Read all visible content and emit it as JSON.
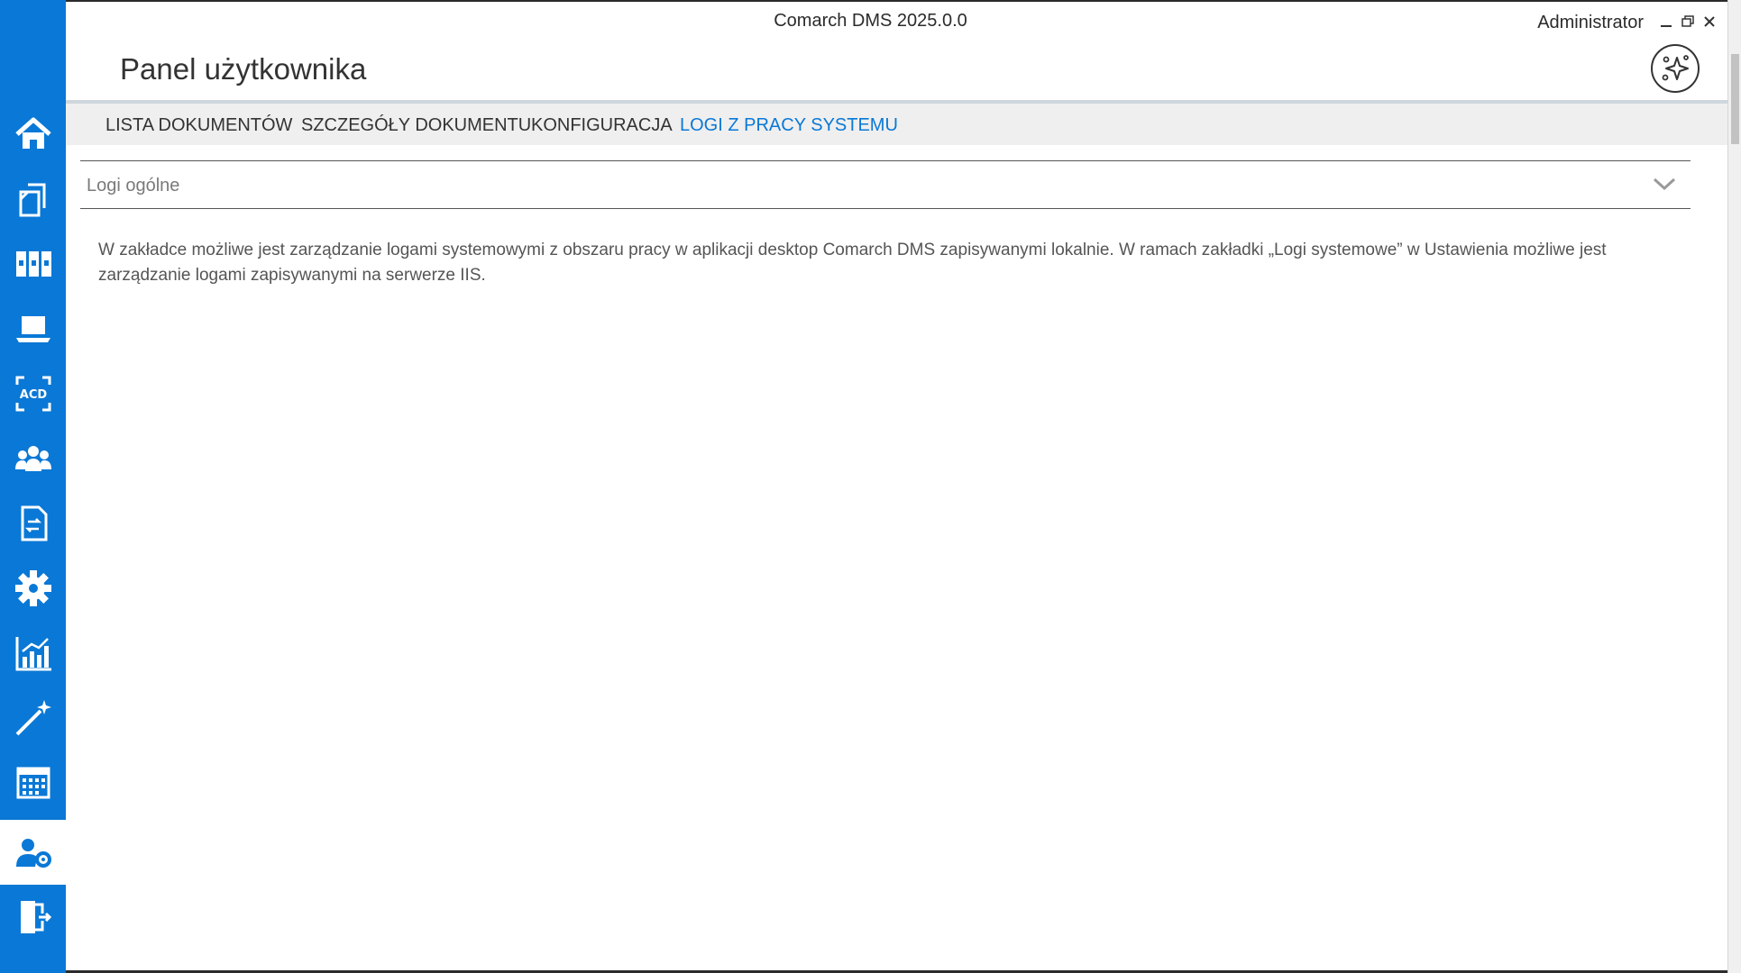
{
  "window": {
    "title": "Comarch DMS 2025.0.0",
    "user": "Administrator",
    "controls": [
      "minimize-icon",
      "restore-icon",
      "close-icon"
    ]
  },
  "page": {
    "title": "Panel użytkownika"
  },
  "sidebar": {
    "items": [
      {
        "name": "home",
        "icon": "home-icon"
      },
      {
        "name": "documents",
        "icon": "documents-icon"
      },
      {
        "name": "repository",
        "icon": "binders-icon"
      },
      {
        "name": "workstation",
        "icon": "laptop-icon"
      },
      {
        "name": "ocr",
        "icon": "acd-scan-icon",
        "label": "ACD"
      },
      {
        "name": "users",
        "icon": "group-icon"
      },
      {
        "name": "workflow",
        "icon": "document-exchange-icon"
      },
      {
        "name": "settings",
        "icon": "gear-icon"
      },
      {
        "name": "reports",
        "icon": "chart-icon"
      },
      {
        "name": "wizard",
        "icon": "magic-wand-icon"
      },
      {
        "name": "calendar",
        "icon": "calendar-icon"
      },
      {
        "name": "user-panel",
        "icon": "user-settings-icon",
        "active": true
      },
      {
        "name": "logout",
        "icon": "exit-door-icon"
      }
    ]
  },
  "tabs": [
    {
      "label": "LISTA DOKUMENTÓW"
    },
    {
      "label": "SZCZEGÓŁY DOKUMENTU"
    },
    {
      "label": "KONFIGURACJA"
    },
    {
      "label": "LOGI Z PRACY SYSTEMU",
      "active": true
    }
  ],
  "section": {
    "title": "Logi ogólne",
    "description": "W zakładce możliwe jest zarządzanie logami systemowymi z obszaru pracy w aplikacji desktop Comarch DMS zapisywanymi lokalnie. W ramach zakładki „Logi systemowe” w Ustawienia możliwe jest zarządzanie logami zapisywanymi na serwerze IIS."
  },
  "colors": {
    "accent": "#0a78d6",
    "text": "#333333",
    "muted": "#7a7a7a"
  }
}
